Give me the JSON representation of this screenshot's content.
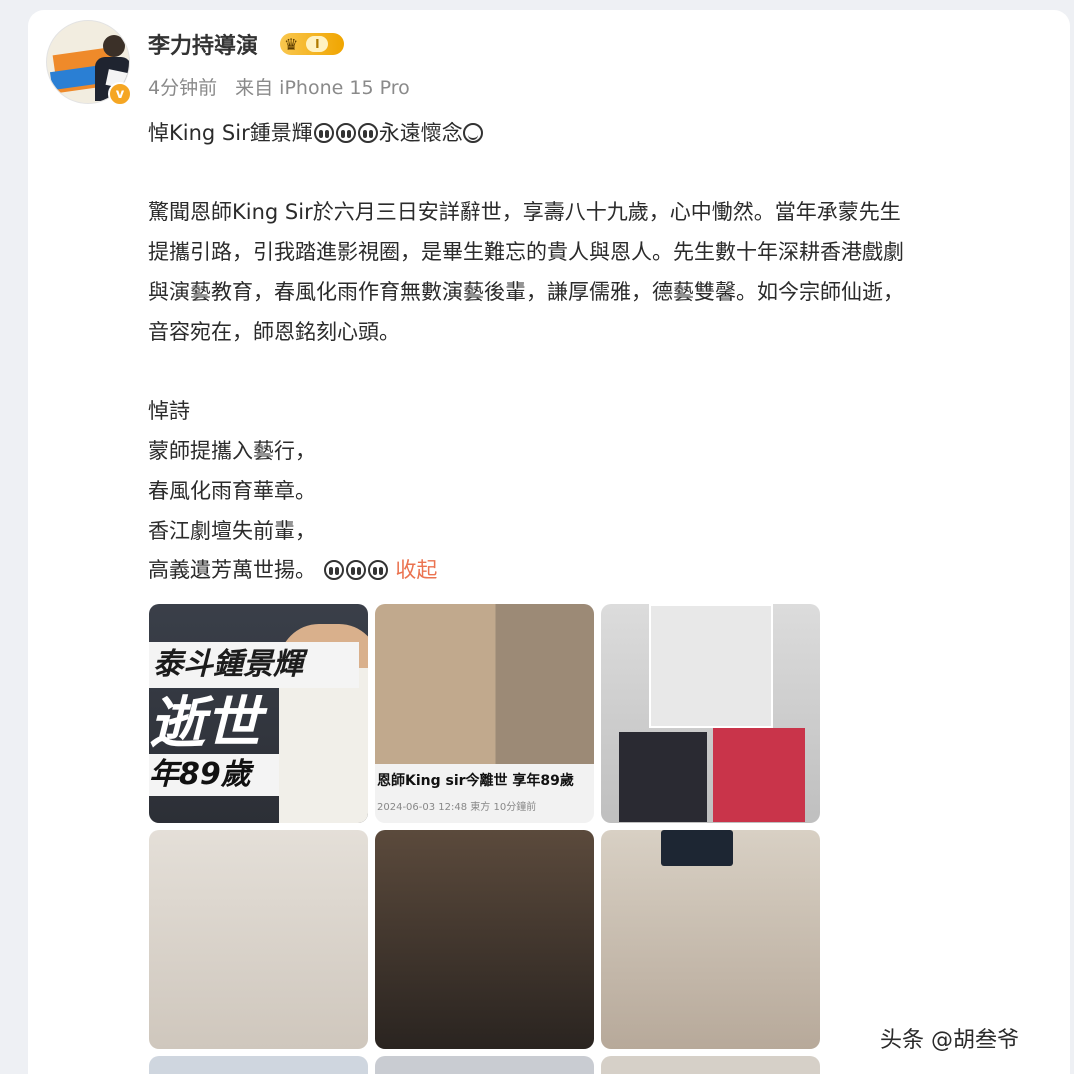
{
  "post": {
    "username": "李力持導演",
    "level": "I",
    "time": "4分钟前",
    "source": "来自 iPhone 15 Pro",
    "line_title_a": "悼King Sir鍾景輝",
    "line_title_b": "永遠懷念",
    "para1": [
      "驚聞恩師King Sir於六月三日安詳辭世，享壽八十九歲，心中慟然。當年承蒙先生",
      "提攜引路，引我踏進影視圈，是畢生難忘的貴人與恩人。先生數十年深耕香港戲劇",
      "與演藝教育，春風化雨作育無數演藝後輩，謙厚儒雅，德藝雙馨。如今宗師仙逝，",
      "音容宛在，師恩銘刻心頭。"
    ],
    "poem_title": "悼詩",
    "poem": [
      "蒙師提攜入藝行，",
      "春風化雨育華章。",
      "香江劇壇失前輩，",
      "高義遺芳萬世揚。"
    ],
    "collapse_label": "收起"
  },
  "images": {
    "img1_title": "泰斗鍾景輝",
    "img1_big": "逝世",
    "img1_age": "年89歲",
    "img2_caption": "恩師King sir今離世 享年89歲",
    "img2_date": "2024-06-03 12:48   東方   10分鐘前"
  },
  "watermark": "头条 @胡叁爷",
  "colors": {
    "accent": "#eb7350",
    "badge_gold": "#f0a500"
  }
}
